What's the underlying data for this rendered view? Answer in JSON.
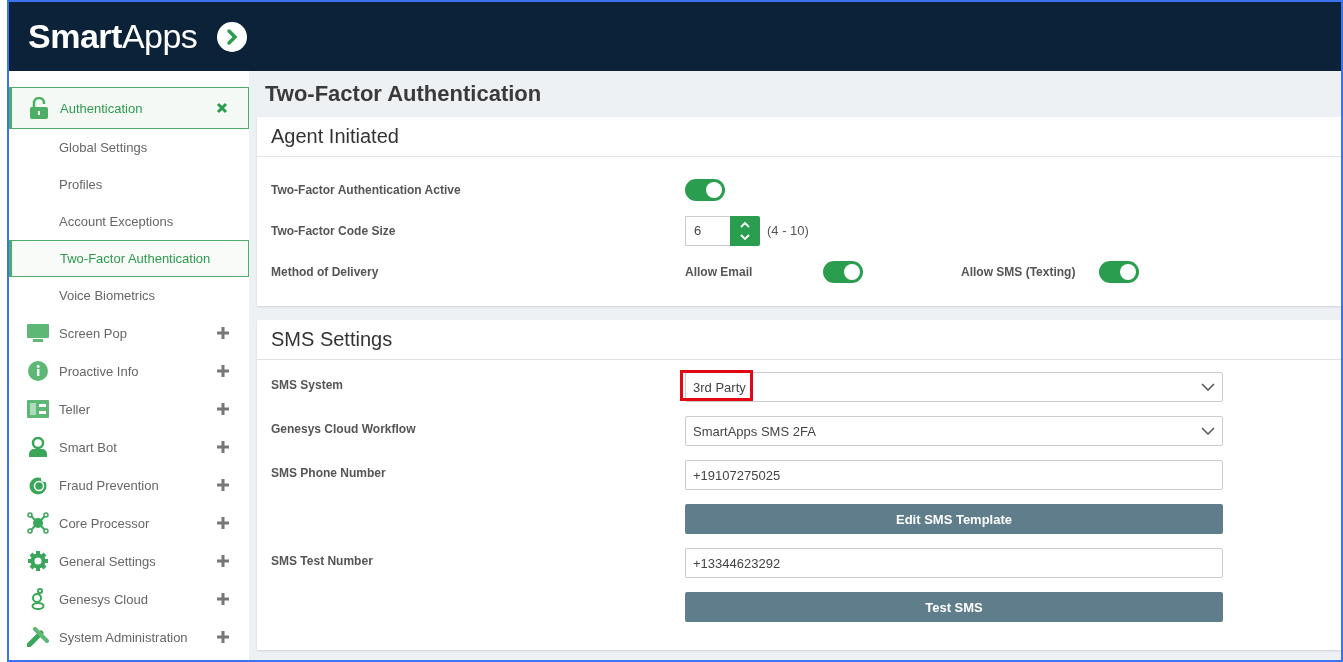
{
  "app": {
    "logo_primary": "Smart",
    "logo_secondary": "Apps"
  },
  "sidebar": {
    "sections": [
      {
        "label": "Authentication",
        "expanded": true,
        "children": [
          {
            "label": "Global Settings",
            "selected": false
          },
          {
            "label": "Profiles",
            "selected": false
          },
          {
            "label": "Account Exceptions",
            "selected": false
          },
          {
            "label": "Two-Factor Authentication",
            "selected": true
          },
          {
            "label": "Voice Biometrics",
            "selected": false
          }
        ]
      },
      {
        "label": "Screen Pop",
        "expanded": false
      },
      {
        "label": "Proactive Info",
        "expanded": false
      },
      {
        "label": "Teller",
        "expanded": false
      },
      {
        "label": "Smart Bot",
        "expanded": false
      },
      {
        "label": "Fraud Prevention",
        "expanded": false
      },
      {
        "label": "Core Processor",
        "expanded": false
      },
      {
        "label": "General Settings",
        "expanded": false
      },
      {
        "label": "Genesys Cloud",
        "expanded": false
      },
      {
        "label": "System Administration",
        "expanded": false
      }
    ]
  },
  "page": {
    "title": "Two-Factor Authentication"
  },
  "agent_initiated": {
    "title": "Agent Initiated",
    "rows": [
      {
        "kind": "toggle",
        "label": "Two-Factor Authentication Active",
        "on": true
      },
      {
        "kind": "number",
        "label": "Two-Factor Code Size",
        "value": "6",
        "range": "(4 - 10)"
      },
      {
        "kind": "options",
        "label": "Method of Delivery",
        "options": [
          {
            "label": "Allow Email",
            "on": true
          },
          {
            "label": "Allow SMS (Texting)",
            "on": true
          }
        ]
      }
    ]
  },
  "sms_settings": {
    "title": "SMS Settings",
    "rows": [
      {
        "kind": "select",
        "label": "SMS System",
        "value": "3rd Party",
        "highlighted": true
      },
      {
        "kind": "select",
        "label": "Genesys Cloud Workflow",
        "value": "SmartApps SMS 2FA",
        "highlighted": false
      },
      {
        "kind": "input",
        "label": "SMS Phone Number",
        "value": "+19107275025"
      },
      {
        "kind": "button",
        "label": "Edit SMS Template"
      },
      {
        "kind": "input",
        "label": "SMS Test Number",
        "value": "+13344623292"
      },
      {
        "kind": "button",
        "label": "Test SMS"
      }
    ]
  }
}
